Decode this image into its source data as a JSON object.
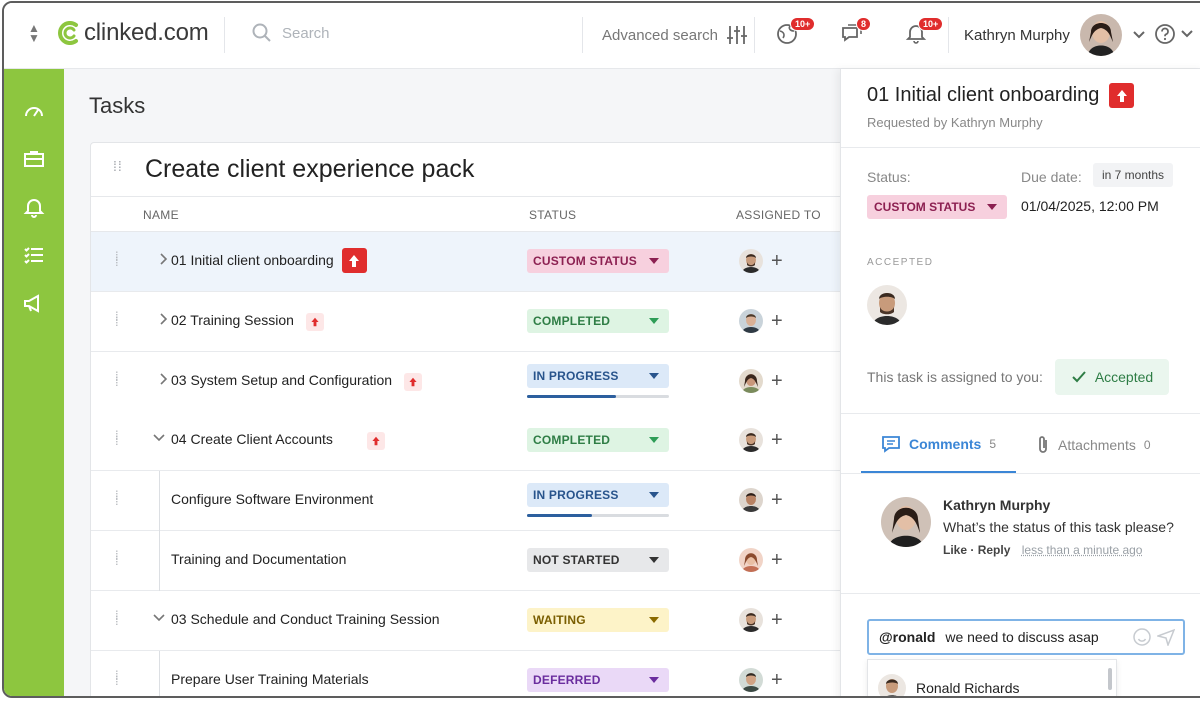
{
  "header": {
    "logo_text": "clinked.com",
    "search_placeholder": "Search",
    "advanced_search": "Advanced search",
    "badges": {
      "globe": "10+",
      "chat": "8",
      "bell": "10+"
    },
    "user_name": "Kathryn Murphy"
  },
  "sidebar": {
    "items": [
      "dashboard-icon",
      "briefcase-icon",
      "bell-icon",
      "checklist-icon",
      "megaphone-icon"
    ]
  },
  "main": {
    "page_title": "Tasks",
    "card_title": "Create client experience pack",
    "columns": {
      "name": "NAME",
      "status": "STATUS",
      "assigned": "ASSIGNED TO"
    },
    "rows": [
      {
        "name": "01 Initial client onboarding",
        "status": "CUSTOM STATUS",
        "progress": null
      },
      {
        "name": "02 Training Session",
        "status": "COMPLETED",
        "progress": null
      },
      {
        "name": "03 System Setup and Configuration",
        "status": "IN PROGRESS",
        "progress": 0.63
      },
      {
        "name": "04 Create Client Accounts",
        "status": "COMPLETED",
        "progress": null
      },
      {
        "name": "Configure Software Environment",
        "status": "IN PROGRESS",
        "progress": 0.46
      },
      {
        "name": "Training and Documentation",
        "status": "NOT STARTED",
        "progress": null
      },
      {
        "name": "03 Schedule and Conduct Training Session",
        "status": "WAITING",
        "progress": null
      },
      {
        "name": "Prepare User Training Materials",
        "status": "DEFERRED",
        "progress": null
      }
    ]
  },
  "panel": {
    "title": "01 Initial client onboarding",
    "requested_by": "Requested by Kathryn Murphy",
    "status_label": "Status:",
    "status_value": "CUSTOM STATUS",
    "due_label": "Due date:",
    "due_pill": "in 7 months",
    "due_value": "01/04/2025, 12:00 PM",
    "accepted_label": "ACCEPTED",
    "assigned_text": "This task is assigned to you:",
    "accepted_button": "Accepted",
    "tabs": {
      "comments": "Comments",
      "comments_count": "5",
      "attachments": "Attachments",
      "attachments_count": "0"
    },
    "comment": {
      "author": "Kathryn Murphy",
      "text": "What’s the status of this task please?",
      "like": "Like",
      "reply": "Reply",
      "ago": "less than a minute ago"
    },
    "input": {
      "mention": "@ronald",
      "text": "we need to discuss asap"
    },
    "suggestion": "Ronald Richards"
  },
  "colors": {
    "brand_green": "#8dc63f",
    "accent_blue": "#3b86d6",
    "priority_red": "#e02d2d"
  }
}
